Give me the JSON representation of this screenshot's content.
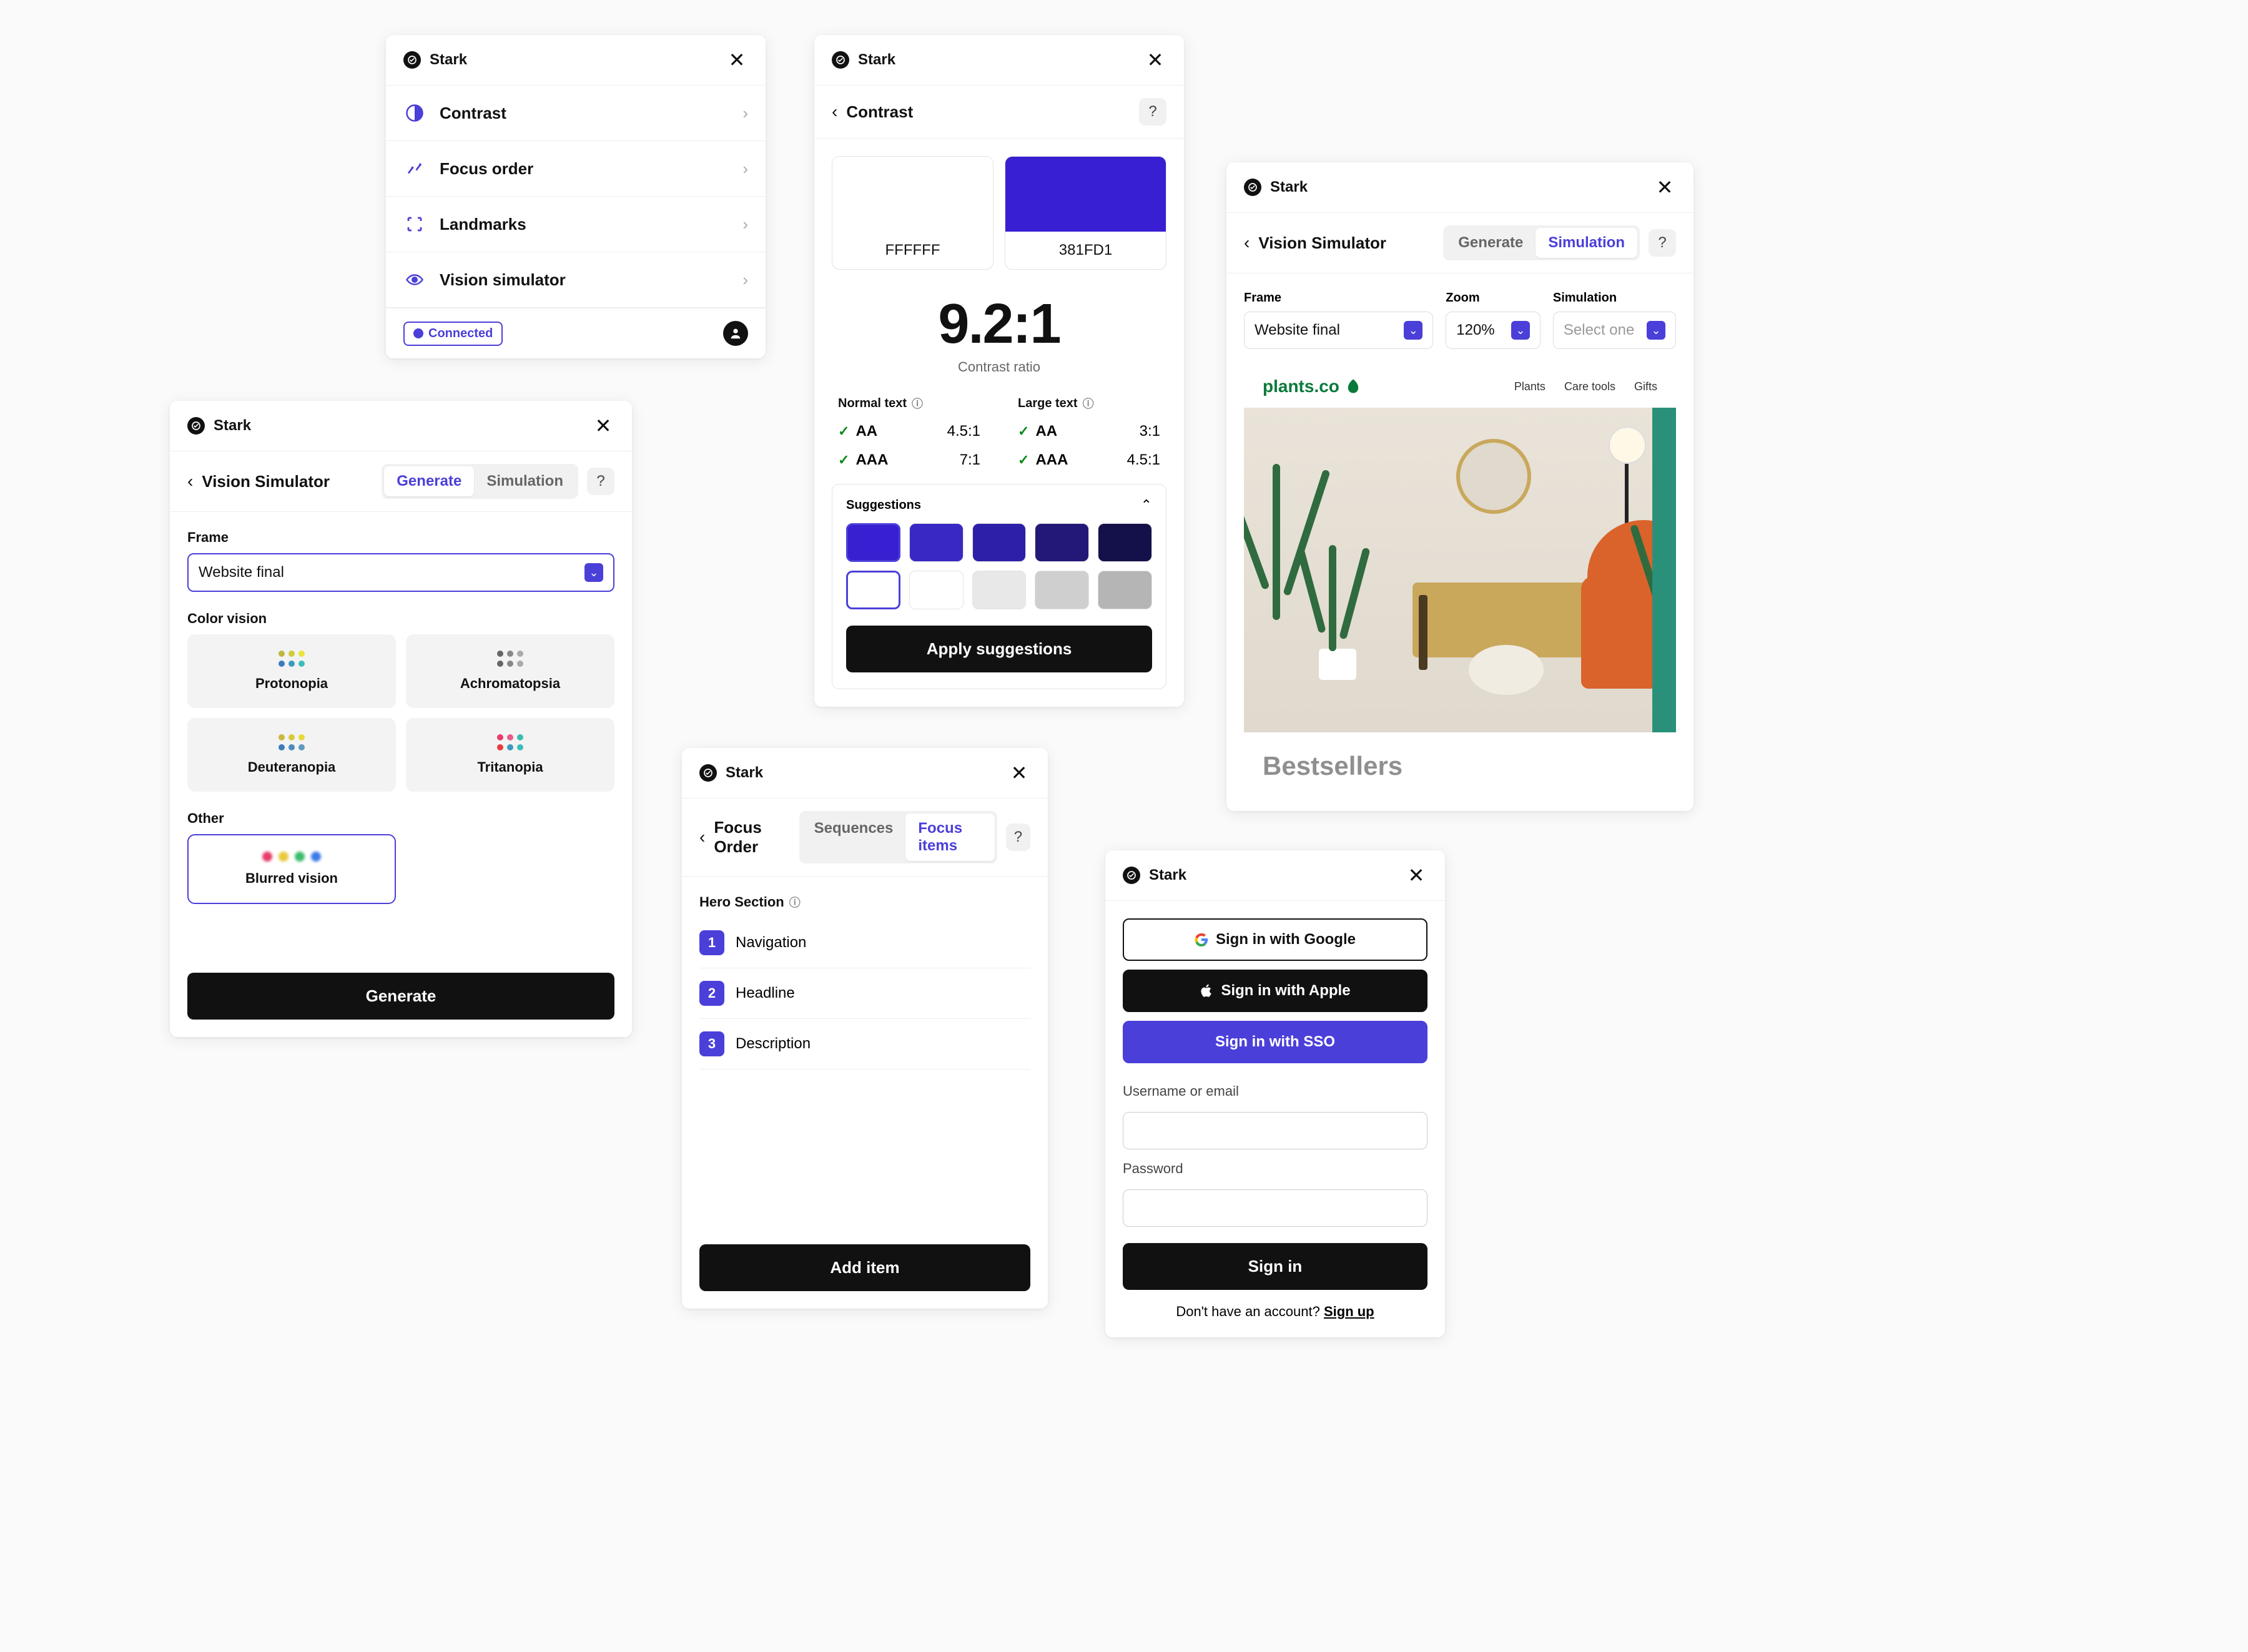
{
  "brand": "Stark",
  "tools_panel": {
    "items": [
      {
        "name": "Contrast"
      },
      {
        "name": "Focus order"
      },
      {
        "name": "Landmarks"
      },
      {
        "name": "Vision simulator"
      }
    ],
    "connected_label": "Connected"
  },
  "vision_gen": {
    "title": "Vision Simulator",
    "tab_generate": "Generate",
    "tab_simulation": "Simulation",
    "frame_label": "Frame",
    "frame_value": "Website final",
    "color_vision_label": "Color vision",
    "cards": {
      "protonopia": "Protonopia",
      "achromatopsia": "Achromatopsia",
      "deuteranopia": "Deuteranopia",
      "tritanopia": "Tritanopia"
    },
    "other_label": "Other",
    "blurred": "Blurred vision",
    "generate_btn": "Generate"
  },
  "contrast": {
    "title": "Contrast",
    "fg_hex": "FFFFFF",
    "bg_hex": "381FD1",
    "fg_color": "#FFFFFF",
    "bg_color": "#381FD1",
    "ratio": "9.2:1",
    "ratio_caption": "Contrast ratio",
    "normal_label": "Normal text",
    "large_label": "Large text",
    "normal": {
      "aa": "AA",
      "aa_val": "4.5:1",
      "aaa": "AAA",
      "aaa_val": "7:1"
    },
    "large": {
      "aa": "AA",
      "aa_val": "3:1",
      "aaa": "AAA",
      "aaa_val": "4.5:1"
    },
    "suggestions_label": "Suggestions",
    "suggestion_colors_row1": [
      "#381FD1",
      "#3A28C4",
      "#2E1FA8",
      "#231877",
      "#14114A"
    ],
    "suggestion_colors_row2": [
      "#FFFFFF",
      "#FFFFFF",
      "#E8E8E8",
      "#CFCFCF",
      "#B5B5B5"
    ],
    "apply_btn": "Apply suggestions"
  },
  "focus": {
    "title": "Focus Order",
    "tab_seq": "Sequences",
    "tab_items": "Focus items",
    "section_label": "Hero Section",
    "items": [
      "Navigation",
      "Headline",
      "Description"
    ],
    "add_btn": "Add item"
  },
  "auth": {
    "google": "Sign in with Google",
    "apple": "Sign in with Apple",
    "sso": "Sign in with SSO",
    "user_label": "Username or email",
    "pass_label": "Password",
    "signin": "Sign in",
    "no_account": "Don't have an account? ",
    "signup": "Sign up"
  },
  "sim": {
    "title": "Vision Simulator",
    "tab_generate": "Generate",
    "tab_simulation": "Simulation",
    "frame_label": "Frame",
    "frame_value": "Website final",
    "zoom_label": "Zoom",
    "zoom_value": "120%",
    "simulation_label": "Simulation",
    "simulation_value": "Select one",
    "site_brand": "plants.co",
    "nav": [
      "Plants",
      "Care tools",
      "Gifts"
    ],
    "section": "Bestsellers"
  }
}
